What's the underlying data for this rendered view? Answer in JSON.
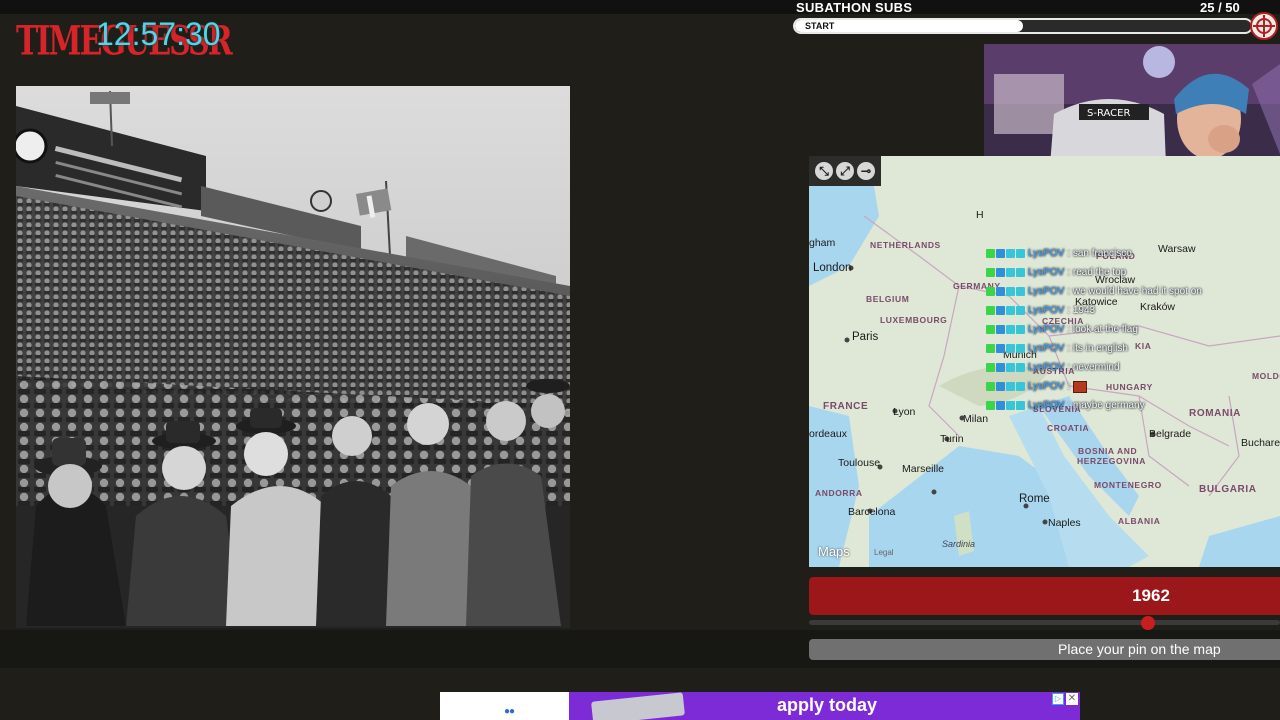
{
  "overlay": {
    "logo_text": "TIMEGUESSR",
    "timer": "12:57:30"
  },
  "subathon": {
    "title": "SUBATHON SUBS",
    "count": "25  / 50",
    "bar_label": "START",
    "progress_fraction": 0.5
  },
  "photo": {
    "description_icon": "stadium-crowd-photo"
  },
  "map": {
    "controls": [
      "expand-icon",
      "shrink-icon",
      "pin-icon"
    ],
    "brand": " Maps",
    "legal": "Legal",
    "labels": {
      "netherlands": "NETHERLANDS",
      "belgium": "BELGIUM",
      "luxembourg": "LUXEMBOURG",
      "germany": "GERMANY",
      "france": "FRANCE",
      "andorra": "ANDORRA",
      "poland": "POLAND",
      "czechia": "CZECHIA",
      "austria": "AUSTRIA",
      "slovenia": "SLOVENIA",
      "croatia": "CROATIA",
      "hungary": "HUNGARY",
      "bosnia_1": "BOSNIA AND",
      "bosnia_2": "HERZEGOVINA",
      "montenegro": "MONTENEGRO",
      "albania": "ALBANIA",
      "romania": "ROMANIA",
      "bulgaria": "BULGARIA",
      "moldova": "MOLDO",
      "slovakia": "KIA",
      "london": "London",
      "paris": "Paris",
      "lyon": "Lyon",
      "bordeaux": "ordeaux",
      "toulouse": "Toulouse",
      "marseille": "Marseille",
      "barcelona": "Barcelona",
      "milan": "Milan",
      "turin": "Turin",
      "rome": "Rome",
      "naples": "Naples",
      "sardinia": "Sardinia",
      "munich": "Munich",
      "wroclaw": "Wroclaw",
      "katowice": "Katowice",
      "krakow": "Kraków",
      "warsaw": "Warsaw",
      "belgrade": "Belgrade",
      "bucharest": "Buchare",
      "birmingham": "gham",
      "hamburg_frag": "H"
    }
  },
  "chat": [
    {
      "user": "LysPOV",
      "msg": ": san francisco",
      "emote": false
    },
    {
      "user": "LysPOV",
      "msg": ": read the top",
      "emote": false
    },
    {
      "user": "LysPOV",
      "msg": ": we would have had it spot on",
      "emote": false
    },
    {
      "user": "LysPOV",
      "msg": ": 1943",
      "emote": false
    },
    {
      "user": "LysPOV",
      "msg": ": look at the flag",
      "emote": false
    },
    {
      "user": "LysPOV",
      "msg": ": its in english",
      "emote": false
    },
    {
      "user": "LysPOV",
      "msg": ": nevermind",
      "emote": false
    },
    {
      "user": "LysPOV",
      "msg": ":",
      "emote": true
    },
    {
      "user": "LysPOV",
      "msg": ": maybe germany",
      "emote": false
    }
  ],
  "game": {
    "year": "1962",
    "slider_fraction": 0.72,
    "place_pin_label": "Place your pin on the map"
  },
  "ad": {
    "text": "apply today",
    "dots": "●●",
    "choices_icon": "▷",
    "close_icon": "✕"
  },
  "colors": {
    "background": "#1f1e18",
    "timer": "#4fd7e8",
    "logo": "#d6242a",
    "year_bar": "#9c171a",
    "ad_purple": "#7c2bd6",
    "chat_user": "#3aa0ff"
  }
}
